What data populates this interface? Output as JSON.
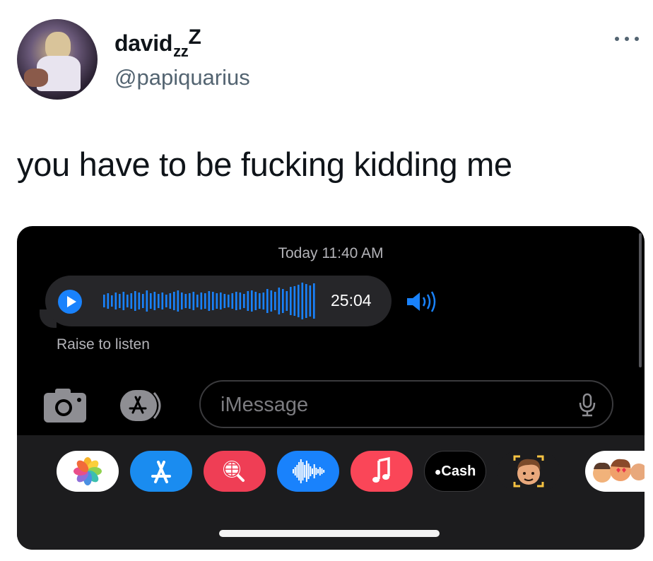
{
  "tweet": {
    "display_name": "davidᵣᵣᶻ",
    "display_name_text": "david",
    "display_name_zzz": "zz",
    "display_name_cap": "Z",
    "handle": "@papiquarius",
    "text": "you have to be fucking kidding me",
    "more_icon": "more-dots-icon"
  },
  "screenshot": {
    "timestamp": "Today 11:40 AM",
    "audio_message": {
      "duration": "25:04",
      "play_icon": "play-icon",
      "accent": "#1982fc"
    },
    "raise_to_listen": "Raise to listen",
    "speaker_icon": "speaker-icon",
    "compose": {
      "camera_icon": "camera-icon",
      "apps_icon": "app-store-icon",
      "placeholder": "iMessage",
      "mic_icon": "microphone-icon"
    },
    "app_drawer": {
      "apps": [
        {
          "name": "photos-app",
          "icon": "photos-icon"
        },
        {
          "name": "app-store",
          "icon": "app-store-icon"
        },
        {
          "name": "images-search",
          "icon": "globe-search-icon"
        },
        {
          "name": "audio-message",
          "icon": "waveform-icon"
        },
        {
          "name": "music",
          "icon": "music-note-icon"
        },
        {
          "name": "apple-cash",
          "icon": "apple-logo-icon",
          "label": "Cash"
        },
        {
          "name": "memoji",
          "icon": "memoji-icon"
        },
        {
          "name": "memoji-stickers",
          "icon": "memoji-stickers-icon"
        }
      ]
    }
  }
}
